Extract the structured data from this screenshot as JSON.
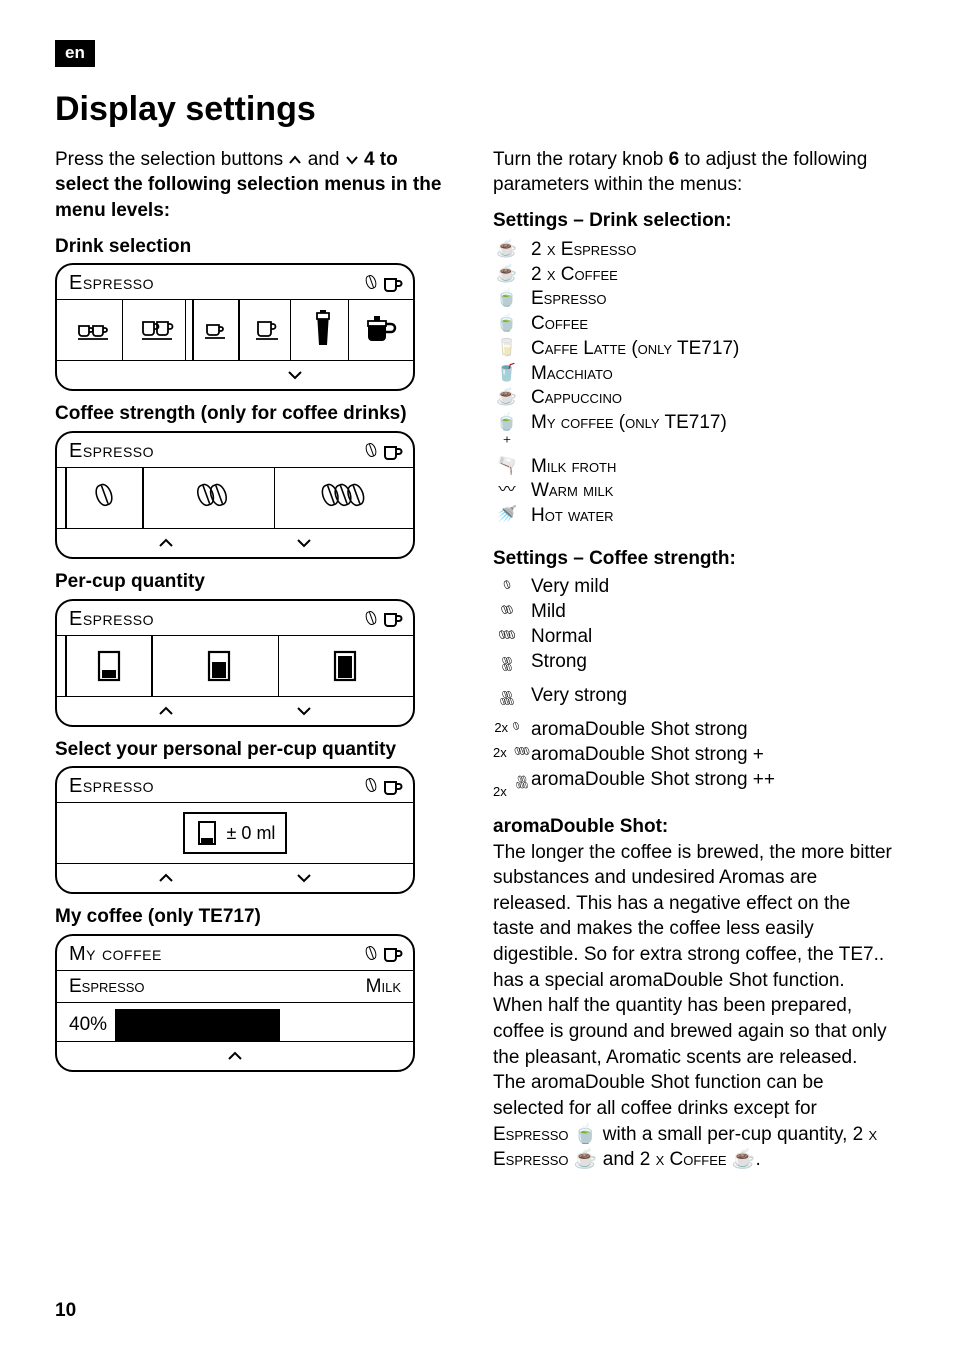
{
  "lang_badge": "en",
  "page_number": "10",
  "title": "Display settings",
  "left": {
    "intro_1": "Press the selection buttons ",
    "intro_2": " and ",
    "intro_3": " 4 to select the following selection menus in the menu levels:",
    "drink_selection_label": "Drink selection",
    "panel_title_espresso": "Espresso",
    "coffee_strength_label": "Coffee strength (only for coffee drinks)",
    "per_cup_label": "Per-cup quantity",
    "personal_label": "Select your personal per-cup quantity",
    "personal_value": "± 0 ml",
    "my_coffee_label": "My coffee (only TE717)",
    "my_coffee_title": "My coffee",
    "my_coffee_row1_left": "Espresso",
    "my_coffee_row1_right": "Milk",
    "my_coffee_row2_left": "40%"
  },
  "right": {
    "intro_1": "Turn the rotary knob ",
    "intro_bold": "6",
    "intro_2": " to adjust the following parameters within the menus:",
    "settings_drink_label": "Settings – Drink selection:",
    "drinks": [
      "2 x Espresso",
      "2 x Coffee",
      "Espresso",
      "Coffee",
      "Caffe Latte (only TE717)",
      "Macchiato",
      "Cappuccino",
      "My coffee (only TE717)",
      "Milk froth",
      "Warm milk",
      "Hot water"
    ],
    "settings_strength_label": "Settings – Coffee strength:",
    "strengths": [
      "Very mild",
      "Mild",
      "Normal",
      "Strong",
      "Very strong",
      "aromaDouble Shot strong",
      "aromaDouble Shot strong +",
      "aromaDouble Shot strong ++"
    ],
    "strength_prefixes": [
      "",
      "",
      "",
      "",
      "",
      "2x",
      "2x",
      "2x"
    ],
    "aroma_heading": "aromaDouble Shot:",
    "aroma_body_1": "The longer the coffee is brewed, the more bitter substances and undesired Aromas are released. This has a negative effect on the taste and makes the coffee less easily digestible. So for extra strong coffee, the TE7.. has a special aromaDouble Shot function. When half the quantity has been prepared, coffee is ground and brewed again so that only the pleasant, Aromatic scents are released. The aromaDouble Shot function can be selected for all coffee drinks except for ",
    "aroma_esp": "Espresso",
    "aroma_body_2": " with a small per-cup quantity, ",
    "aroma_2esp": "2 x Espresso",
    "aroma_body_3": " and ",
    "aroma_2cof": "2 x Coffee",
    "aroma_body_4": "."
  }
}
